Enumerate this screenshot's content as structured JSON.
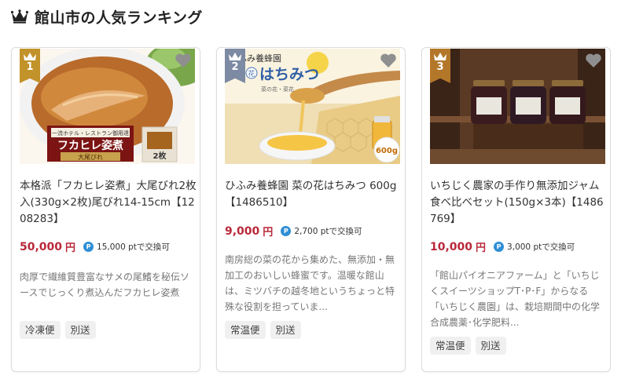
{
  "header": {
    "title": "館山市の人気ランキング",
    "icon": "crown-icon"
  },
  "colors": {
    "price": "#b9283a",
    "rank_1": "#c2922b",
    "rank_2": "#7d8aa3",
    "rank_3": "#b3772a",
    "point_icon": "#2f8fd6",
    "tag_bg": "#f0f0f0"
  },
  "products": [
    {
      "rank": "1",
      "image_icon": "shark-fin-soup-image",
      "image_text": {
        "top": "一流ホテル・レストラン御用達",
        "main": "フカヒレ姿煮",
        "sub": "大尾びれ",
        "pack": "2枚"
      },
      "name": "本格派「フカヒレ姿煮」大尾びれ2枚入(330g×2枚)尾びれ14-15cm【1208283】",
      "price": "50,000",
      "yen": "円",
      "point_badge": "P",
      "points": "15,000 ptで交換可",
      "description": "肉厚で繊維質豊富なサメの尾鰭を秘伝ソースでじっくり煮込んだフカヒレ姿煮",
      "tags": [
        "冷凍便",
        "別送"
      ]
    },
    {
      "rank": "2",
      "image_icon": "honey-image",
      "image_text": {
        "brand": "ひふみ養蜂園",
        "flower": "花",
        "main": "はちみつ",
        "sub": "菜の花・菜花",
        "size": "600g"
      },
      "name": "ひふみ養蜂園 菜の花はちみつ 600g【1486510】",
      "price": "9,000",
      "yen": "円",
      "point_badge": "P",
      "points": "2,700 ptで交換可",
      "description": "南房総の菜の花から集めた、無添加・無加工のおいしい蜂蜜です。温暖な館山は、ミツバチの越冬地というちょっと特殊な役割を担っていま...",
      "tags": [
        "常温便",
        "別送"
      ]
    },
    {
      "rank": "3",
      "image_icon": "fig-jam-jars-image",
      "image_text": {},
      "name": "いちじく農家の手作り無添加ジャム　食べ比べセット(150g×3本)【1486769】",
      "price": "10,000",
      "yen": "円",
      "point_badge": "P",
      "points": "3,000 ptで交換可",
      "description": "「館山パイオニアファーム」と「いちじくスイーツショップT･P･F」からなる「いちじく農園」は、栽培期間中の化学合成農薬･化学肥料...",
      "tags": [
        "常温便",
        "別送"
      ]
    }
  ]
}
